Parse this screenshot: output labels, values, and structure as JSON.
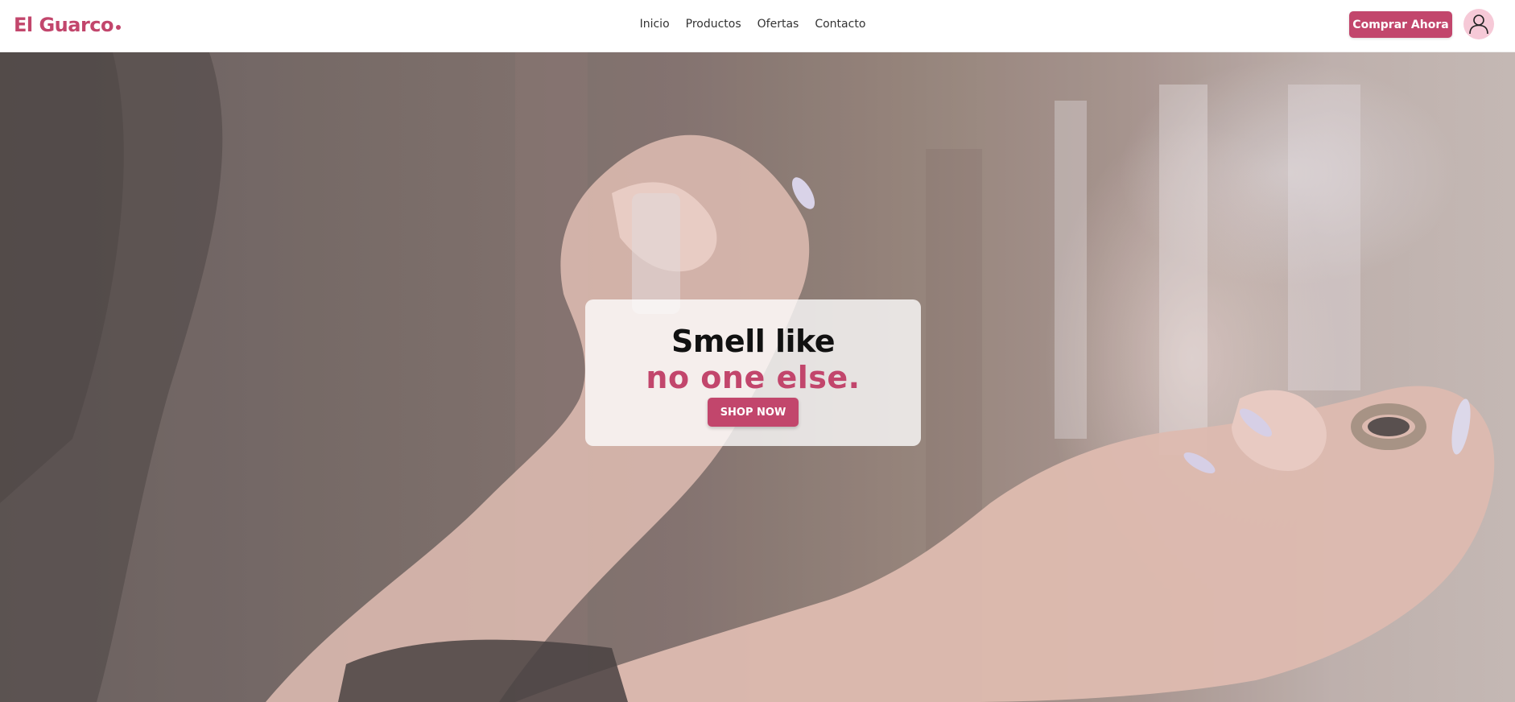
{
  "brand": {
    "name": "El Guarco",
    "accent_color": "#c2466c"
  },
  "nav": {
    "links": [
      "Inicio",
      "Productos",
      "Ofertas",
      "Contacto"
    ]
  },
  "header": {
    "cta_label": "Comprar Ahora",
    "avatar_icon": "user-icon"
  },
  "hero": {
    "line1": "Smell like",
    "line2": "no one else.",
    "button_label": "SHOP NOW"
  }
}
